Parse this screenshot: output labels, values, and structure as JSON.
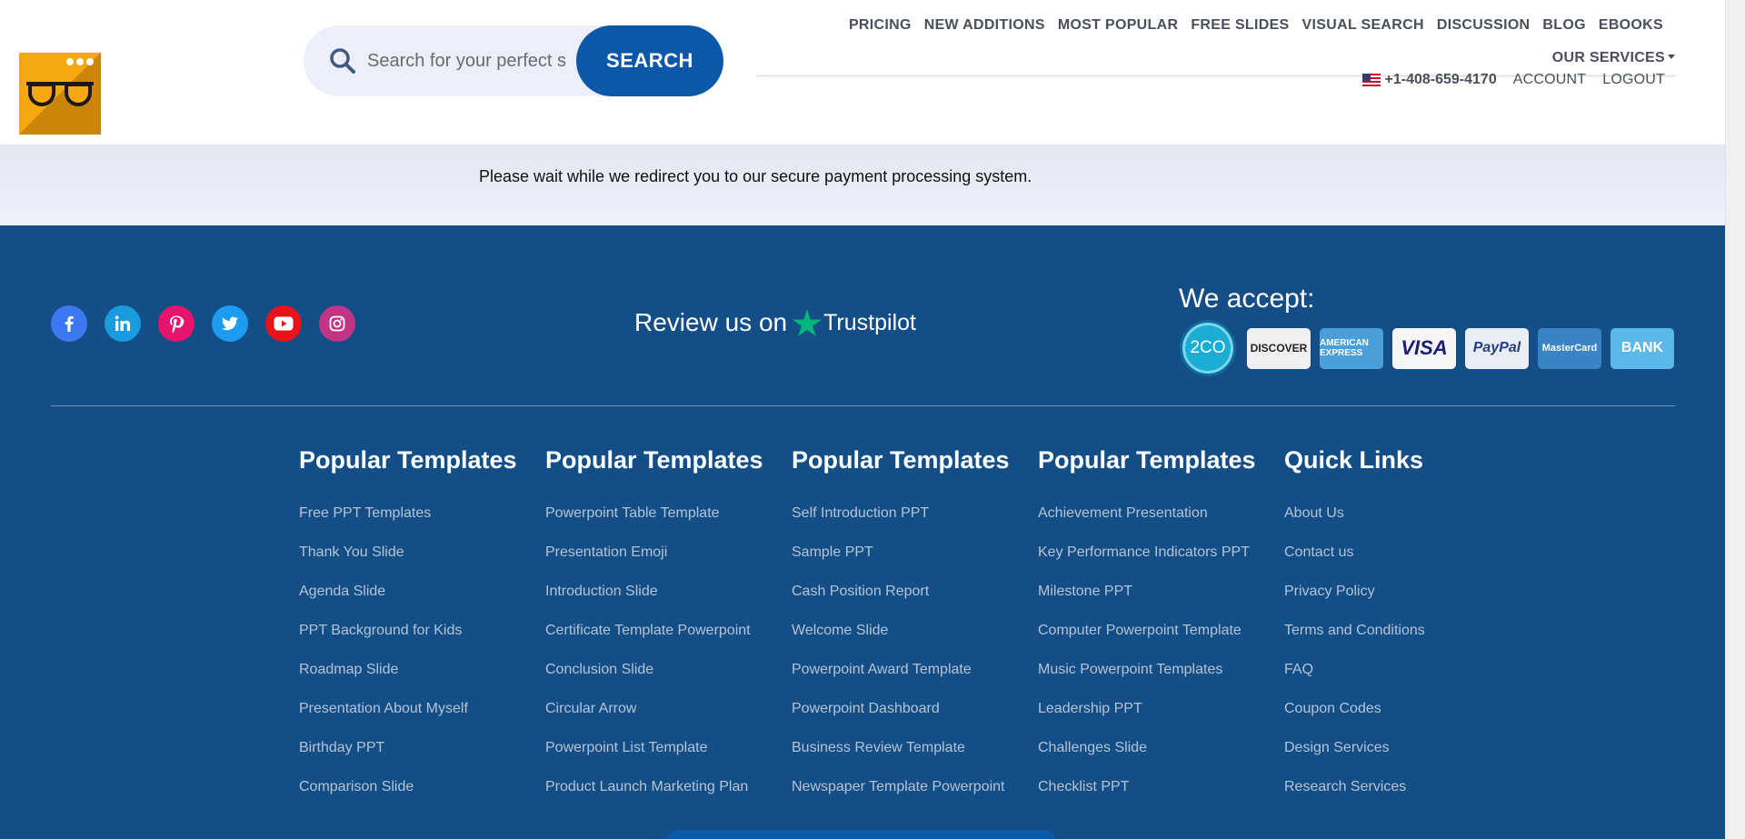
{
  "header": {
    "search": {
      "placeholder": "Search for your perfect sl",
      "button_label": "SEARCH"
    },
    "nav": [
      "PRICING",
      "NEW ADDITIONS",
      "MOST POPULAR",
      "FREE SLIDES",
      "VISUAL SEARCH",
      "DISCUSSION",
      "BLOG",
      "EBOOKS"
    ],
    "services_label": "OUR SERVICES",
    "phone": "+1-408-659-4170",
    "account_label": "ACCOUNT",
    "logout_label": "LOGOUT"
  },
  "redirect": {
    "message": "Please wait while we redirect you to our secure payment processing system."
  },
  "footer": {
    "social_icons": [
      "facebook-icon",
      "linkedin-icon",
      "pinterest-icon",
      "twitter-icon",
      "youtube-icon",
      "instagram-icon"
    ],
    "social_colors": [
      "#3b77f0",
      "#1a9be0",
      "#e7146b",
      "#1d9bf0",
      "#e8131b",
      "#c13584"
    ],
    "review_prefix": "Review us on",
    "review_brand": "Trustpilot",
    "accept_label": "We accept:",
    "payment_methods": [
      "2CO",
      "DISCOVER",
      "AMERICAN EXPRESS",
      "VISA",
      "PayPal",
      "MasterCard",
      "BANK"
    ],
    "columns": [
      {
        "heading": "Popular Templates",
        "links": [
          "Free PPT Templates",
          "Thank You Slide",
          "Agenda Slide",
          "PPT Background for Kids",
          "Roadmap Slide",
          "Presentation About Myself",
          "Birthday PPT",
          "Comparison Slide"
        ]
      },
      {
        "heading": "Popular Templates",
        "links": [
          "Powerpoint Table Template",
          "Presentation Emoji",
          "Introduction Slide",
          "Certificate Template Powerpoint",
          "Conclusion Slide",
          "Circular Arrow",
          "Powerpoint List Template",
          "Product Launch Marketing Plan"
        ]
      },
      {
        "heading": "Popular Templates",
        "links": [
          "Self Introduction PPT",
          "Sample PPT",
          "Cash Position Report",
          "Welcome Slide",
          "Powerpoint Award Template",
          "Powerpoint Dashboard",
          "Business Review Template",
          "Newspaper Template Powerpoint"
        ]
      },
      {
        "heading": "Popular Templates",
        "links": [
          "Achievement Presentation",
          "Key Performance Indicators PPT",
          "Milestone PPT",
          "Computer Powerpoint Template",
          "Music Powerpoint Templates",
          "Leadership PPT",
          "Challenges Slide",
          "Checklist PPT"
        ]
      },
      {
        "heading": "Quick Links",
        "links": [
          "About Us",
          "Contact us",
          "Privacy Policy",
          "Terms and Conditions",
          "FAQ",
          "Coupon Codes",
          "Design Services",
          "Research Services"
        ]
      }
    ]
  },
  "colors": {
    "brand_blue": "#0c58a8",
    "footer_bg": "#134e86",
    "logo_orange": "#f5a810",
    "trustpilot_green": "#00b67a"
  }
}
